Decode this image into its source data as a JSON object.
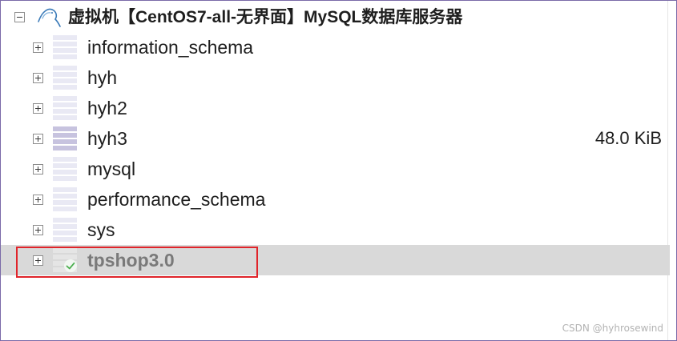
{
  "tree": {
    "root": {
      "label": "虚拟机【CentOS7-all-无界面】MySQL数据库服务器",
      "icon": "mysql-dolphin-icon",
      "expanded": true
    },
    "databases": [
      {
        "name": "information_schema",
        "size": ""
      },
      {
        "name": "hyh",
        "size": ""
      },
      {
        "name": "hyh2",
        "size": ""
      },
      {
        "name": "hyh3",
        "size": "48.0 KiB"
      },
      {
        "name": "mysql",
        "size": ""
      },
      {
        "name": "performance_schema",
        "size": ""
      },
      {
        "name": "sys",
        "size": ""
      },
      {
        "name": "tpshop3.0",
        "size": "",
        "selected": true,
        "status_icon": "check-icon"
      }
    ]
  },
  "watermark": {
    "text": "CSDN @hyhrosewind"
  },
  "colors": {
    "selection_bg": "#d9d9d9",
    "highlight_border": "#e0242a",
    "window_border": "#7a6aa8",
    "check_green": "#4caf50"
  }
}
